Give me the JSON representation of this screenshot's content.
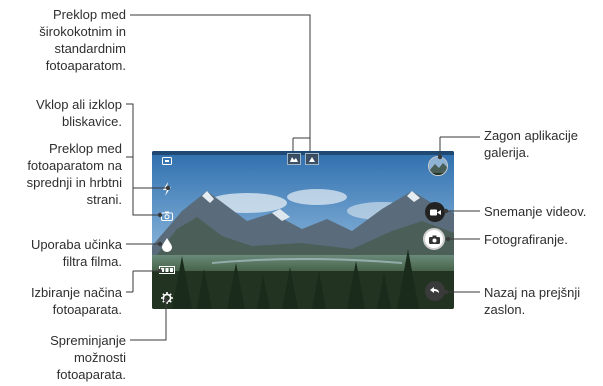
{
  "labels": {
    "wide_toggle": "Preklop med\nširokokotnim in\nstandardnim\nfotoaparatom.",
    "flash": "Vklop ali izklop\nbliskavice.",
    "switch_camera": "Preklop med\nfotoaparatom na\nsprednji in hrbtni\nstrani.",
    "film_filter": "Uporaba učinka\nfiltra filma.",
    "camera_mode": "Izbiranje načina\nfotoaparata.",
    "settings": "Spreminjanje\nmožnosti\nfotoaparata.",
    "gallery": "Zagon aplikacije\ngalerija.",
    "record_video": "Snemanje videov.",
    "take_photo": "Fotografiranje.",
    "back": "Nazaj na prejšnji\nzaslon."
  },
  "icons": {
    "hdr": "hdr-icon",
    "flash": "flash-icon",
    "switch_camera": "switch-camera-icon",
    "film_filter": "film-filter-icon",
    "mode": "mode-icon",
    "settings": "gear-icon",
    "wide": "wide-angle-icon",
    "standard": "standard-angle-icon",
    "video": "video-camera-icon",
    "shutter": "camera-icon",
    "back": "back-arrow-icon",
    "gallery": "gallery-thumbnail-icon"
  }
}
